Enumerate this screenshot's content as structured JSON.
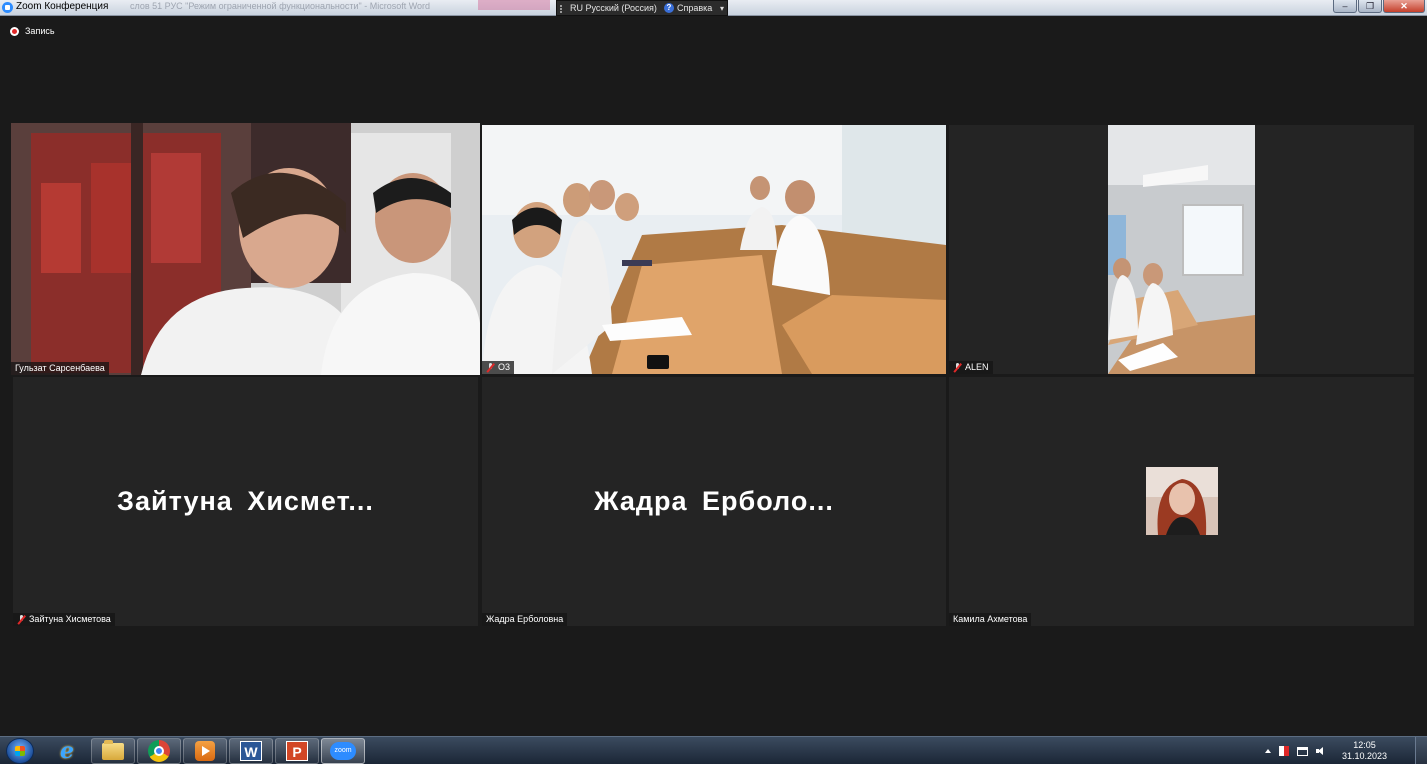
{
  "window": {
    "title": "Zoom Конференция",
    "behind_text": "слов 51 РУС    \"Режим ограниченной функциональности\" - Microsoft Word",
    "buttons": {
      "minimize": "–",
      "maximize": "❐",
      "close": "✕"
    }
  },
  "language_bar": {
    "language": "RU Русский (Россия)",
    "help_icon": "?",
    "help": "Справка",
    "minimize": "▾"
  },
  "recording": {
    "label": "Запись"
  },
  "participants": [
    {
      "name": "Гульзат Сарсенбаева",
      "muted": false,
      "video": true,
      "active_speaker": true
    },
    {
      "name": "О3",
      "muted": true,
      "video": true
    },
    {
      "name": "ALEN",
      "muted": true,
      "video": true
    },
    {
      "name": "Зайтуна Хисметова",
      "display_name": "Зайтуна  Хисмет...",
      "muted": true,
      "video": false
    },
    {
      "name": "Жадра Ерболовна",
      "display_name": "Жадра  Ерболо...",
      "muted": false,
      "video": false
    },
    {
      "name": "Камила Ахметова",
      "muted": false,
      "video": false,
      "avatar": true
    }
  ],
  "taskbar": {
    "apps": [
      "start",
      "internet-explorer",
      "explorer",
      "chrome",
      "media-player",
      "word",
      "powerpoint",
      "zoom"
    ],
    "word_letter": "W",
    "ppt_letter": "P",
    "zoom_label": "zoom",
    "ie_letter": "e",
    "clock": {
      "time": "12:05",
      "date": "31.10.2023"
    }
  },
  "colors": {
    "active_speaker_border": "#d6e84a",
    "background": "#1a1a1a",
    "tile": "#242424"
  }
}
